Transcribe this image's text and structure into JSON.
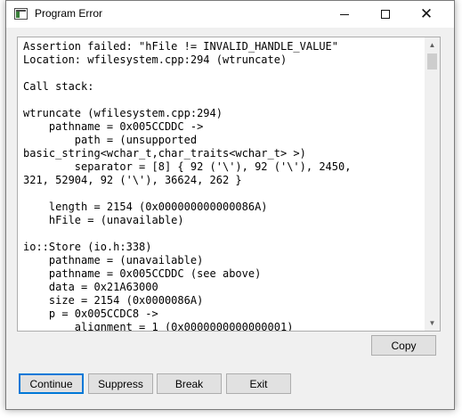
{
  "window": {
    "title": "Program Error"
  },
  "titlebar": {
    "minimize_glyph": "",
    "close_glyph": "✕"
  },
  "error_text": "Assertion failed: \"hFile != INVALID_HANDLE_VALUE\"\nLocation: wfilesystem.cpp:294 (wtruncate)\n\nCall stack:\n\nwtruncate (wfilesystem.cpp:294)\n    pathname = 0x005CCDDC ->\n        path = (unsupported\nbasic_string<wchar_t,char_traits<wchar_t> >)\n        separator = [8] { 92 ('\\'), 92 ('\\'), 2450,\n321, 52904, 92 ('\\'), 36624, 262 }\n\n    length = 2154 (0x000000000000086A)\n    hFile = (unavailable)\n\nio::Store (io.h:338)\n    pathname = (unavailable)\n    pathname = 0x005CCDDC (see above)\n    data = 0x21A63000\n    size = 2154 (0x0000086A)\n    p = 0x005CCDC8 ->\n        alignment = 1 (0x0000000000000001)",
  "scrollbar": {
    "up_glyph": "▲",
    "down_glyph": "▼"
  },
  "buttons": {
    "copy": "Copy",
    "continue": "Continue",
    "suppress": "Suppress",
    "break": "Break",
    "exit": "Exit"
  }
}
